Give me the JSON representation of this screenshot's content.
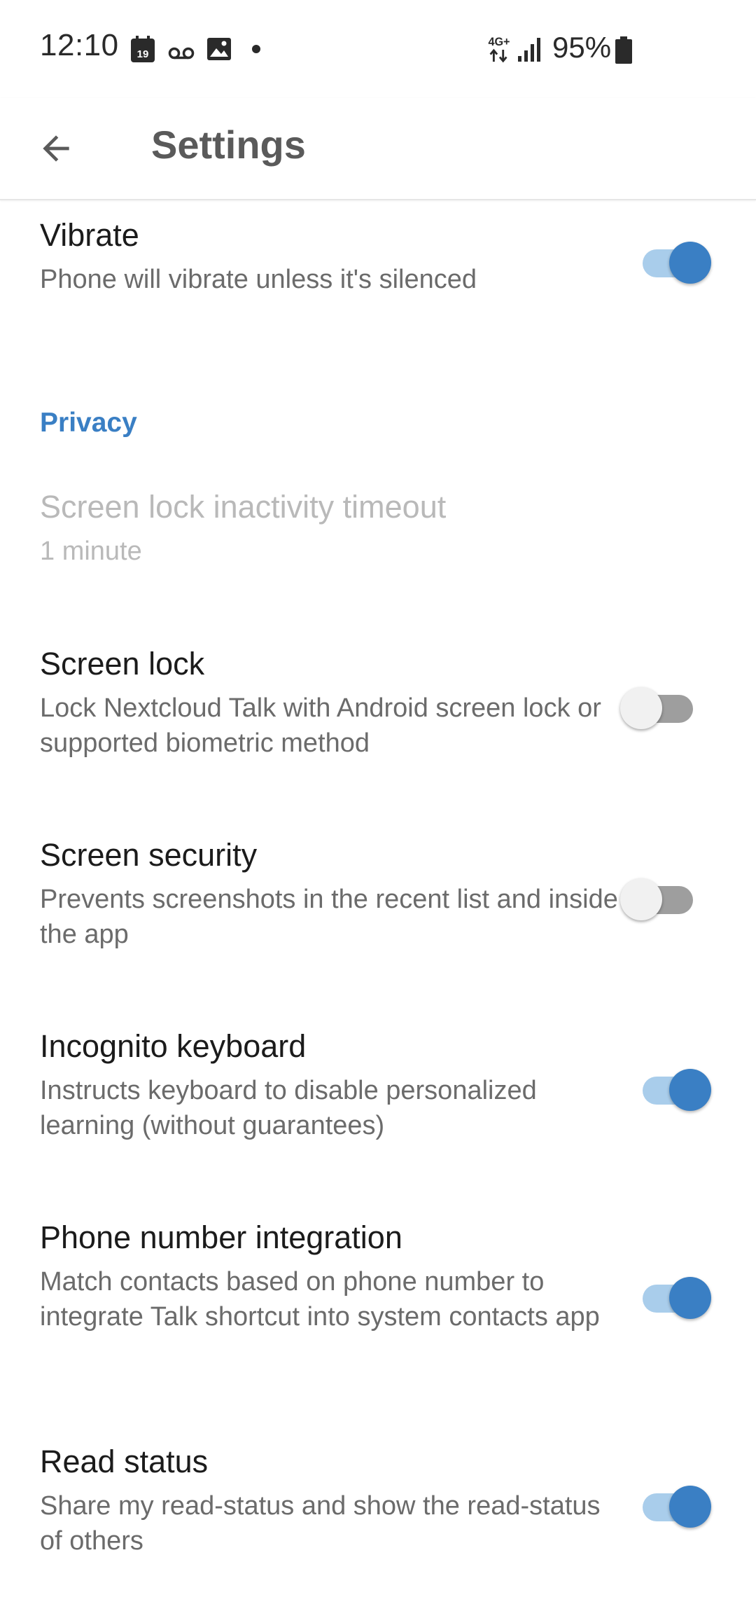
{
  "status_bar": {
    "time": "12:10",
    "calendar_day": "19",
    "battery_percent": "95%",
    "network": "4G+",
    "icons": [
      "calendar-icon",
      "voicemail-icon",
      "gallery-icon",
      "notification-dot-icon",
      "network-4g-icon",
      "signal-icon",
      "battery-icon"
    ]
  },
  "app_bar": {
    "back_icon": "arrow-back-icon",
    "title": "Settings"
  },
  "accent_color": "#3a7fc4",
  "preferences": {
    "vibrate": {
      "title": "Vibrate",
      "summary": "Phone will vibrate unless it's silenced",
      "enabled": true
    },
    "privacy_header": "Privacy",
    "screen_lock_timeout": {
      "title": "Screen lock inactivity timeout",
      "summary": "1 minute",
      "disabled": true
    },
    "screen_lock": {
      "title": "Screen lock",
      "summary": "Lock Nextcloud Talk with Android screen lock or supported biometric method",
      "enabled": false
    },
    "screen_security": {
      "title": "Screen security",
      "summary": "Prevents screenshots in the recent list and inside the app",
      "enabled": false
    },
    "incognito_keyboard": {
      "title": "Incognito keyboard",
      "summary": "Instructs keyboard to disable personalized learning (without guarantees)",
      "enabled": true
    },
    "phone_number_integration": {
      "title": "Phone number integration",
      "summary": "Match contacts based on phone number to integrate Talk shortcut into system contacts app",
      "enabled": true
    },
    "read_status": {
      "title": "Read status",
      "summary": "Share my read-status and show the read-status of others",
      "enabled": true
    }
  }
}
